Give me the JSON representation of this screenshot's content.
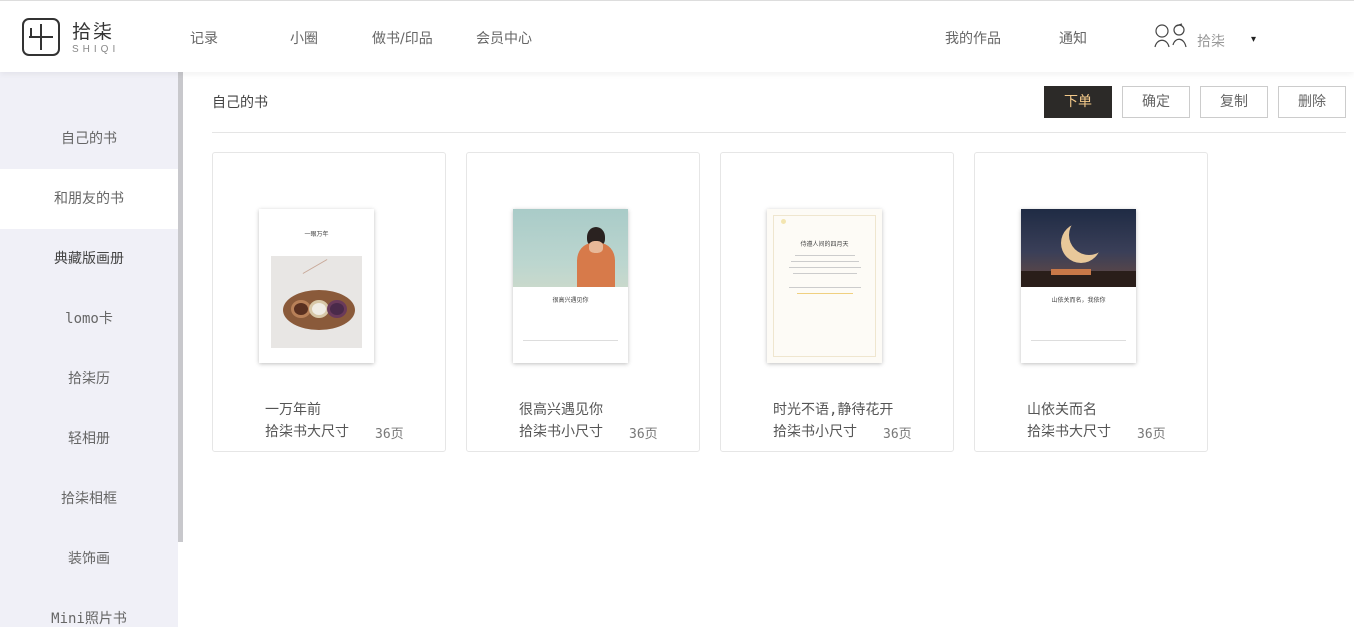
{
  "header": {
    "logo_cn": "拾柒",
    "logo_en": "SHIQI",
    "nav": [
      "记录",
      "小圈",
      "做书/印品",
      "会员中心"
    ],
    "right_nav": [
      "我的作品",
      "通知"
    ],
    "user_name": "拾柒",
    "caret": "▾"
  },
  "sidebar": {
    "items": [
      {
        "label": "自己的书"
      },
      {
        "label": "和朋友的书"
      },
      {
        "label": "典藏版画册"
      },
      {
        "label": "lomo卡"
      },
      {
        "label": "拾柒历"
      },
      {
        "label": "轻相册"
      },
      {
        "label": "拾柒相框"
      },
      {
        "label": "装饰画"
      },
      {
        "label": "Mini照片书"
      }
    ]
  },
  "main": {
    "section_title": "自己的书",
    "buttons": {
      "order": "下单",
      "confirm": "确定",
      "copy": "复制",
      "delete": "删除"
    },
    "books": [
      {
        "title": "一万年前",
        "type": "拾柒书大尺寸",
        "pages": "36页",
        "cover_title": "一眼万年"
      },
      {
        "title": "很高兴遇见你",
        "type": "拾柒书小尺寸",
        "pages": "36页",
        "cover_title": "很高兴遇见你"
      },
      {
        "title": "时光不语,静待花开",
        "type": "拾柒书小尺寸",
        "pages": "36页",
        "cover_title": "侍遵人间的四月天"
      },
      {
        "title": "山依关而名",
        "type": "拾柒书大尺寸",
        "pages": "36页",
        "cover_title": "山依关而名，我依你"
      }
    ]
  },
  "colors": {
    "accent_dark": "#2c2a28",
    "accent_text": "#f3c98a",
    "sidebar_bg": "#f0f0f7"
  }
}
